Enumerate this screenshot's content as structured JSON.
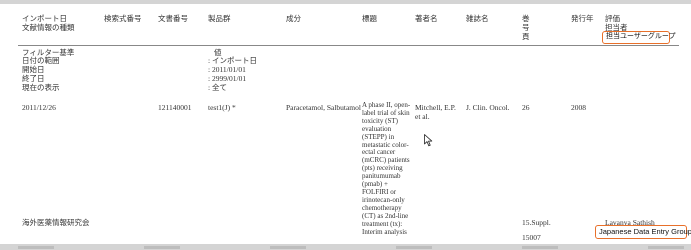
{
  "columns": {
    "import_date": "インポート日",
    "doc_type": "文献情報の種類",
    "hash_no": "検索式番号",
    "doc_no": "文書番号",
    "product_group": "製品群",
    "ingredient": "成分",
    "title": "標題",
    "authors": "著者名",
    "journal": "雑誌名",
    "volume": "巻",
    "issue": "号",
    "pages": "頁",
    "year": "発行年",
    "evaluation": "評価",
    "owner": "担当者",
    "owner_group": "担当ユーザーグループ"
  },
  "filter": {
    "title": "フィルター基準",
    "value_title": "値",
    "rows": [
      {
        "label": "日付の範囲",
        "value": ": インポート日"
      },
      {
        "label": "開始日",
        "value": ": 2011/01/01"
      },
      {
        "label": "終了日",
        "value": ": 2999/01/01"
      },
      {
        "label": "現在の表示",
        "value": ": 全て"
      }
    ]
  },
  "record": {
    "import_date": "2011/12/26",
    "doc_no": "121140001",
    "product_group": "test1(J) *",
    "ingredient": "Paracetamol, Salbutamol",
    "title": "A phase II, open-label trial of skin toxicity (ST) evaluation (STEPP) in metastatic color-ectal cancer (mCRC) patients (pts) receiving panitumumab (pmab) + FOLFIRI or irinotecan-only chemotherapy (CT) as 2nd-line treatment (tx): Interim analysis",
    "authors": "Mitchell, E.P. et al.",
    "journal": "J. Clin. Oncol.",
    "volume": "26",
    "year": "2008",
    "doc_type": "海外医薬情報研究会",
    "issue": "15.Suppl.",
    "pages": "15007",
    "owner": "Lavanya Sathish",
    "owner_group": "Japanese Data Entry Group"
  },
  "colors": {
    "highlight_border": "#e8702a",
    "rule": "#888888",
    "text": "#333333"
  },
  "icons": [
    "mouse-pointer-icon"
  ]
}
